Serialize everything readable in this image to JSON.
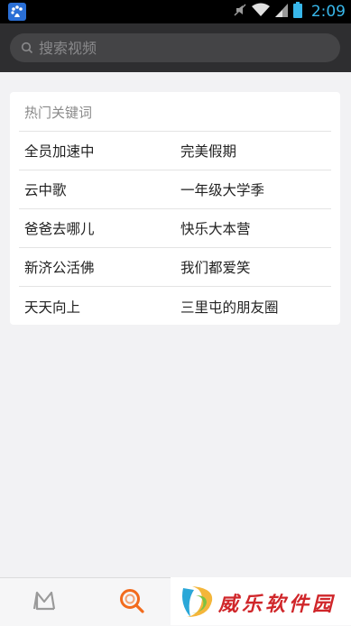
{
  "status": {
    "time": "2:09"
  },
  "search": {
    "placeholder": "搜索视频"
  },
  "hot": {
    "title": "热门关键词",
    "rows": [
      [
        "全员加速中",
        "完美假期"
      ],
      [
        "云中歌",
        "一年级大学季"
      ],
      [
        "爸爸去哪儿",
        "快乐大本营"
      ],
      [
        "新济公活佛",
        "我们都爱笑"
      ],
      [
        "天天向上",
        "三里屯的朋友圈"
      ]
    ]
  },
  "watermark": {
    "text": "威乐软件园"
  },
  "colors": {
    "accent": "#f26b1d",
    "status_blue": "#38b7ea",
    "header_bg": "#2e2e30"
  }
}
